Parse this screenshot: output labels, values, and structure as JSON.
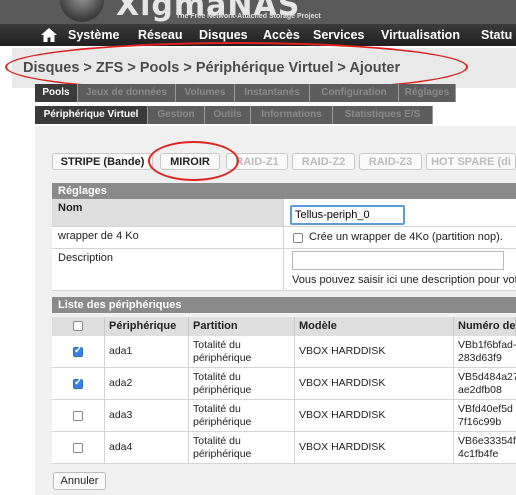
{
  "logo": {
    "name": "XigmaNAS",
    "tagline": "The Free Network-Attached Storage Project"
  },
  "topnav": [
    "Système",
    "Réseau",
    "Disques",
    "Accès",
    "Services",
    "Virtualisation",
    "Statu"
  ],
  "breadcrumb": "Disques > ZFS > Pools > Périphérique Virtuel > Ajouter",
  "tabs_row1": [
    "Pools",
    "Jeux de données",
    "Volumes",
    "Instantanés",
    "Configuration",
    "Réglages"
  ],
  "tabs_row2": [
    "Périphérique Virtuel",
    "Gestion",
    "Outils",
    "Informations",
    "Statistiques E/S"
  ],
  "raid_types": [
    "STRIPE (Bande)",
    "MIROIR",
    "RAID-Z1",
    "RAID-Z2",
    "RAID-Z3",
    "HOT SPARE (di"
  ],
  "settings": {
    "header": "Réglages",
    "name_label": "Nom",
    "name_value": "Tellus-periph_0",
    "wrapper_label": "wrapper de 4 Ko",
    "wrapper_text": "Crée un wrapper de 4Ko (partition nop).",
    "description_label": "Description",
    "description_value": "",
    "description_help": "Vous pouvez saisir ici une description pour vot"
  },
  "devices": {
    "header": "Liste des périphériques",
    "columns": [
      "Périphérique",
      "Partition",
      "Modèle",
      "Numéro de"
    ],
    "rows": [
      {
        "checked": true,
        "device": "ada1",
        "partition": "Totalité du périphérique",
        "model": "VBOX HARDDISK",
        "serial_1": "VBb1f6bfad-",
        "serial_2": "283d63f9"
      },
      {
        "checked": true,
        "device": "ada2",
        "partition": "Totalité du périphérique",
        "model": "VBOX HARDDISK",
        "serial_1": "VB5d484a27",
        "serial_2": "ae2dfb08"
      },
      {
        "checked": false,
        "device": "ada3",
        "partition": "Totalité du périphérique",
        "model": "VBOX HARDDISK",
        "serial_1": "VBfd40ef5d",
        "serial_2": "7f16c99b"
      },
      {
        "checked": false,
        "device": "ada4",
        "partition": "Totalité du périphérique",
        "model": "VBOX HARDDISK",
        "serial_1": "VB6e33354f",
        "serial_2": "4c1fb4fe"
      }
    ]
  },
  "cancel_label": "Annuler",
  "colors": {
    "annotation": "#e0231f",
    "focus": "#5b9dd9",
    "checkbox": "#3b82e0"
  }
}
